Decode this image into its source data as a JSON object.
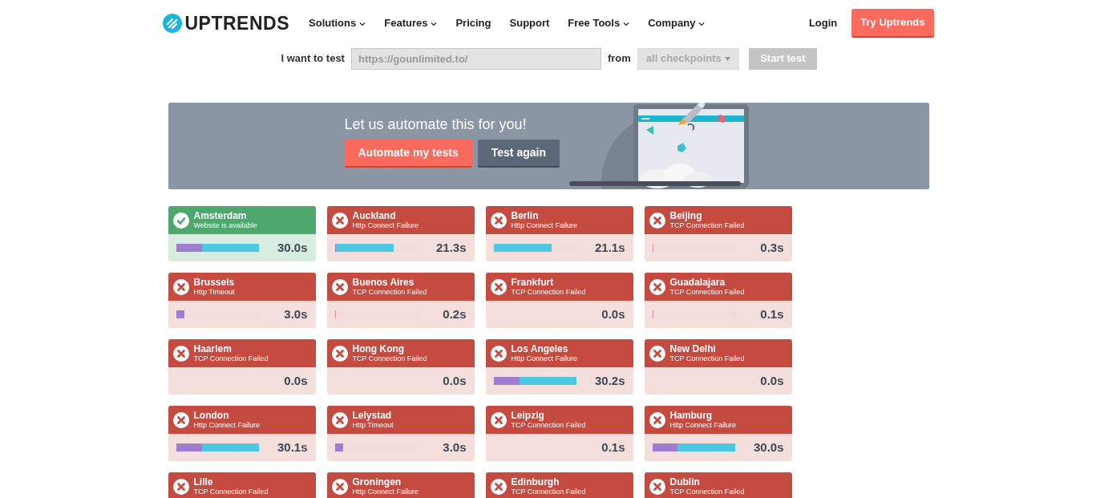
{
  "nav": {
    "logo": "UPTRENDS",
    "items": [
      {
        "label": "Solutions",
        "dropdown": true
      },
      {
        "label": "Features",
        "dropdown": true
      },
      {
        "label": "Pricing",
        "dropdown": false
      },
      {
        "label": "Support",
        "dropdown": false
      },
      {
        "label": "Free Tools",
        "dropdown": true
      },
      {
        "label": "Company",
        "dropdown": true
      }
    ],
    "login": "Login",
    "cta": "Try Uptrends"
  },
  "test_form": {
    "label": "I want to test",
    "url": "https://gounlimited.to/",
    "from_label": "from",
    "checkpoints": "all checkpoints",
    "start_button": "Start test",
    "start_disabled": true
  },
  "banner": {
    "text": "Let us automate this for you!",
    "primary_button": "Automate my tests",
    "secondary_button": "Test again"
  },
  "results": [
    {
      "city": "Amsterdam",
      "failed": false,
      "message": "Website is available",
      "time": "30.0s",
      "bar": [
        {
          "kind": "connect",
          "level": 0.31
        },
        {
          "kind": "download",
          "level": 0.69
        }
      ]
    },
    {
      "city": "Auckland",
      "failed": true,
      "message": "Http Connect Failure",
      "time": "21.3s",
      "bar": [
        {
          "kind": "connect",
          "level": 0.01
        },
        {
          "kind": "download",
          "level": 0.7
        }
      ]
    },
    {
      "city": "Berlin",
      "failed": true,
      "message": "Http Connect Failure",
      "time": "21.1s",
      "bar": [
        {
          "kind": "download",
          "level": 0.7
        }
      ]
    },
    {
      "city": "Beijing",
      "failed": true,
      "message": "TCP Connection Failed",
      "time": "0.3s",
      "bar": [
        {
          "kind": "dns",
          "level": 0.01
        }
      ]
    },
    {
      "city": "Brussels",
      "failed": true,
      "message": "Http Timeout",
      "time": "3.0s",
      "bar": [
        {
          "kind": "connect",
          "level": 0.1
        }
      ]
    },
    {
      "city": "Buenos Aires",
      "failed": true,
      "message": "TCP Connection Failed",
      "time": "0.2s",
      "bar": [
        {
          "kind": "dns",
          "level": 0.01
        }
      ]
    },
    {
      "city": "Frankfurt",
      "failed": true,
      "message": "TCP Connection Failed",
      "time": "0.0s"
    },
    {
      "city": "Guadalajara",
      "failed": true,
      "message": "TCP Connection Failed",
      "time": "0.1s",
      "bar": [
        {
          "kind": "dns",
          "level": 0.01
        }
      ]
    },
    {
      "city": "Haarlem",
      "failed": true,
      "message": "TCP Connection Failed",
      "time": "0.0s"
    },
    {
      "city": "Hong Kong",
      "failed": true,
      "message": "TCP Connection Failed",
      "time": "0.0s"
    },
    {
      "city": "Los Angeles",
      "failed": true,
      "message": "Http Connect Failure",
      "time": "30.2s",
      "bar": [
        {
          "kind": "connect",
          "level": 0.31
        },
        {
          "kind": "download",
          "level": 0.69
        }
      ]
    },
    {
      "city": "New Delhi",
      "failed": true,
      "message": "TCP Connection Failed",
      "time": "0.0s"
    },
    {
      "city": "London",
      "failed": true,
      "message": "Http Connect Failure",
      "time": "30.1s",
      "bar": [
        {
          "kind": "connect",
          "level": 0.31
        },
        {
          "kind": "download",
          "level": 0.69
        }
      ]
    },
    {
      "city": "Lelystad",
      "failed": true,
      "message": "Http Timeout",
      "time": "3.0s",
      "bar": [
        {
          "kind": "connect",
          "level": 0.1
        }
      ]
    },
    {
      "city": "Leipzig",
      "failed": true,
      "message": "TCP Connection Failed",
      "time": "0.1s"
    },
    {
      "city": "Hamburg",
      "failed": true,
      "message": "Http Connect Failure",
      "time": "30.0s",
      "bar": [
        {
          "kind": "connect",
          "level": 0.3
        },
        {
          "kind": "download",
          "level": 0.7
        }
      ]
    },
    {
      "city": "Lille",
      "failed": true,
      "message": "TCP Connection Failed"
    },
    {
      "city": "Groningen",
      "failed": true,
      "message": "Http Connect Failure"
    },
    {
      "city": "Edinburgh",
      "failed": true,
      "message": "TCP Connection Failed"
    },
    {
      "city": "Dublin",
      "failed": true,
      "message": "TCP Connection Failed"
    }
  ]
}
